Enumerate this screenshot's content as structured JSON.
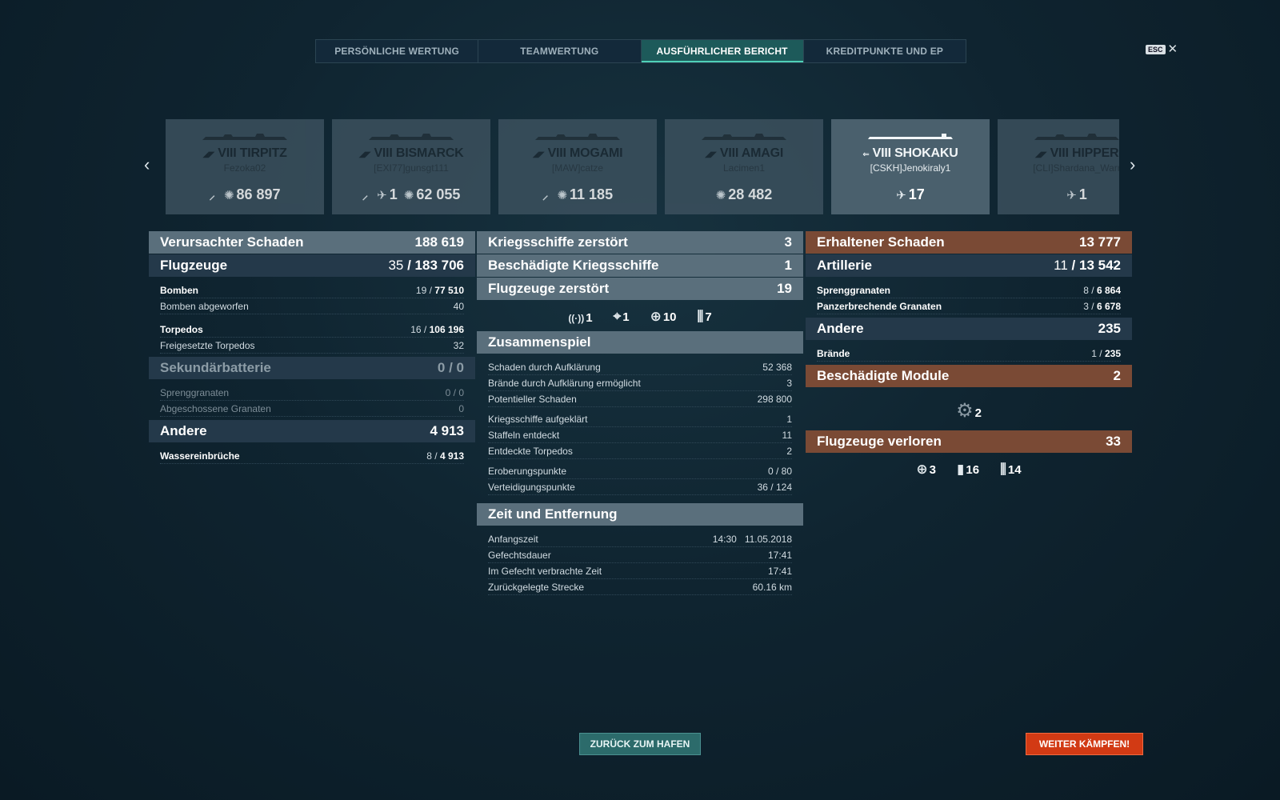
{
  "tabs": [
    "PERSÖNLICHE WERTUNG",
    "TEAMWERTUNG",
    "AUSFÜHRLICHER BERICHT",
    "KREDITPUNKTE UND EP"
  ],
  "esc": {
    "key": "ESC",
    "close": "✕"
  },
  "nav": {
    "prev": "‹",
    "next": "›"
  },
  "cards": [
    {
      "tier": "VIII",
      "name": "TIRPITZ",
      "player": "Fezoka02",
      "stats": [
        {
          "icon": "torpedo-hit-icon",
          "glyph": "⸝",
          "value": ""
        },
        {
          "icon": "flooding-icon",
          "glyph": "✺",
          "value": "86 897"
        }
      ]
    },
    {
      "tier": "VIII",
      "name": "BISMARCK",
      "player": "[EXI77]gunsgt111",
      "stats": [
        {
          "icon": "torpedo-hit-icon",
          "glyph": "⸝",
          "value": ""
        },
        {
          "icon": "plane-shot-icon",
          "glyph": "✈",
          "value": "1"
        },
        {
          "icon": "flooding-icon",
          "glyph": "✺",
          "value": "62 055"
        }
      ]
    },
    {
      "tier": "VIII",
      "name": "MOGAMI",
      "player": "[MAW]catze",
      "stats": [
        {
          "icon": "torpedo-hit-icon",
          "glyph": "⸝",
          "value": ""
        },
        {
          "icon": "flooding-icon",
          "glyph": "✺",
          "value": "11 185"
        }
      ]
    },
    {
      "tier": "VIII",
      "name": "AMAGI",
      "player": "Lacimen1",
      "stats": [
        {
          "icon": "flooding-icon",
          "glyph": "✺",
          "value": "28 482"
        }
      ]
    },
    {
      "tier": "VIII",
      "name": "SHOKAKU",
      "player": "[CSKH]Jenokiraly1",
      "stats": [
        {
          "icon": "plane-shot-icon",
          "glyph": "✈",
          "value": "17"
        }
      ]
    },
    {
      "tier": "VIII",
      "name": "HIPPER",
      "player": "[CLI]Shardana_Warr",
      "stats": [
        {
          "icon": "plane-shot-icon",
          "glyph": "✈",
          "value": "1"
        }
      ]
    }
  ],
  "left": {
    "damage": {
      "label": "Verursachter Schaden",
      "value": "188 619"
    },
    "aircraft": {
      "label": "Flugzeuge",
      "value_a": "35",
      "value_b": "183 706"
    },
    "bombs": {
      "label": "Bomben",
      "value_a": "19",
      "value_b": "77 510"
    },
    "bombs_dropped": {
      "label": "Bomben abgeworfen",
      "value": "40"
    },
    "torpedos": {
      "label": "Torpedos",
      "value_a": "16",
      "value_b": "106 196"
    },
    "torpedos_released": {
      "label": "Freigesetzte Torpedos",
      "value": "32"
    },
    "secondary": {
      "label": "Sekundärbatterie",
      "value": "0 / 0"
    },
    "he_shells": {
      "label": "Sprenggranaten",
      "value": "0 / 0"
    },
    "shells_fired": {
      "label": "Abgeschossene Granaten",
      "value": "0"
    },
    "other": {
      "label": "Andere",
      "value": "4 913"
    },
    "flooding": {
      "label": "Wassereinbrüche",
      "value_a": "8",
      "value_b": "4 913"
    }
  },
  "center": {
    "warships_destroyed": {
      "label": "Kriegsschiffe zerstört",
      "value": "3"
    },
    "warships_damaged": {
      "label": "Beschädigte Kriegsschiffe",
      "value": "1"
    },
    "aircraft_destroyed": {
      "label": "Flugzeuge zerstört",
      "value": "19"
    },
    "icons": [
      {
        "name": "spotting-icon",
        "glyph": "((·))",
        "value": "1"
      },
      {
        "name": "crosshair-icon",
        "glyph": "⌖",
        "value": "1"
      },
      {
        "name": "fighter-target-icon",
        "glyph": "⊕",
        "value": "10"
      },
      {
        "name": "torpedo-bomber-icon",
        "glyph": "⫼",
        "value": "7"
      }
    ],
    "teamplay": {
      "label": "Zusammenspiel"
    },
    "teamplay_rows": [
      {
        "label": "Schaden durch Aufklärung",
        "value": "52 368"
      },
      {
        "label": "Brände durch Aufklärung ermöglicht",
        "value": "3"
      },
      {
        "label": "Potentieller Schaden",
        "value": "298 800"
      },
      {
        "label": "Kriegsschiffe aufgeklärt",
        "value": "1"
      },
      {
        "label": "Staffeln entdeckt",
        "value": "11"
      },
      {
        "label": "Entdeckte Torpedos",
        "value": "2"
      },
      {
        "label": "Eroberungspunkte",
        "value": "0 / 80"
      },
      {
        "label": "Verteidigungspunkte",
        "value": "36 / 124"
      }
    ],
    "time": {
      "label": "Zeit und Entfernung"
    },
    "time_rows": [
      {
        "label": "Anfangszeit",
        "value": "14:30   11.05.2018"
      },
      {
        "label": "Gefechtsdauer",
        "value": "17:41"
      },
      {
        "label": "Im Gefecht verbrachte Zeit",
        "value": "17:41"
      },
      {
        "label": "Zurückgelegte Strecke",
        "value": "60.16 km"
      }
    ]
  },
  "right": {
    "received": {
      "label": "Erhaltener Schaden",
      "value": "13 777"
    },
    "artillery": {
      "label": "Artillerie",
      "value_a": "11",
      "value_b": "13 542"
    },
    "he": {
      "label": "Sprenggranaten",
      "value_a": "8",
      "value_b": "6 864"
    },
    "ap": {
      "label": "Panzerbrechende Granaten",
      "value_a": "3",
      "value_b": "6 678"
    },
    "other": {
      "label": "Andere",
      "value": "235"
    },
    "fires": {
      "label": "Brände",
      "value_a": "1",
      "value_b": "235"
    },
    "modules": {
      "label": "Beschädigte Module",
      "value": "2"
    },
    "module_icon": {
      "glyph": "⚙",
      "value": "2"
    },
    "planes_lost": {
      "label": "Flugzeuge verloren",
      "value": "33"
    },
    "icons": [
      {
        "name": "fighter-target-icon",
        "glyph": "⊕",
        "value": "3"
      },
      {
        "name": "bomb-icon",
        "glyph": "▮",
        "value": "16"
      },
      {
        "name": "torpedo-bomber-icon",
        "glyph": "⫼",
        "value": "14"
      }
    ]
  },
  "buttons": {
    "back": "ZURÜCK ZUM HAFEN",
    "fight": "WEITER KÄMPFEN!"
  }
}
